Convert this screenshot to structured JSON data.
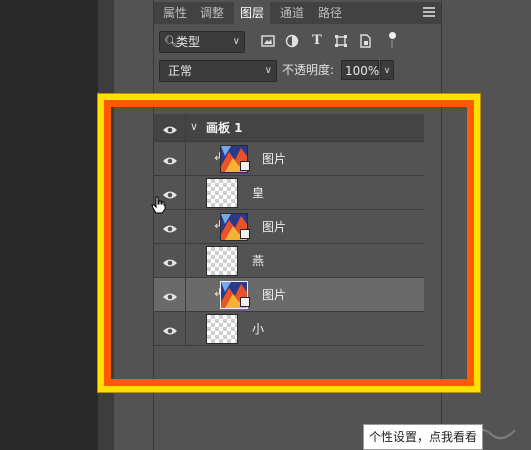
{
  "panel": {
    "tabs": [
      {
        "label": "属性"
      },
      {
        "label": "调整"
      },
      {
        "label": "图层"
      },
      {
        "label": "通道"
      },
      {
        "label": "路径"
      }
    ],
    "active_tab": "图层"
  },
  "filter": {
    "kind_label": "类型",
    "icons": [
      "pixel-layer-filter-icon",
      "adjustment-layer-filter-icon",
      "type-layer-filter-icon",
      "shape-layer-filter-icon",
      "smart-object-filter-icon"
    ]
  },
  "blend": {
    "mode": "正常",
    "opacity_label": "不透明度:",
    "opacity_value": "100%"
  },
  "layers": {
    "group": {
      "name": "画板 1"
    },
    "items": [
      {
        "name": "图片",
        "kind": "smart-object",
        "clipped": true,
        "selected": false
      },
      {
        "name": "皇",
        "kind": "text",
        "clipped": false,
        "selected": false
      },
      {
        "name": "图片",
        "kind": "smart-object",
        "clipped": true,
        "selected": false
      },
      {
        "name": "燕",
        "kind": "text",
        "clipped": false,
        "selected": false
      },
      {
        "name": "图片",
        "kind": "smart-object",
        "clipped": true,
        "selected": true
      },
      {
        "name": "小",
        "kind": "text",
        "clipped": false,
        "selected": false
      }
    ]
  },
  "tooltip": {
    "text": "个性设置，点我看看"
  },
  "colors": {
    "highlight_outer": "#ffe000",
    "highlight_inner": "#ff5a00",
    "panel_bg": "#535353",
    "selected_row": "#6a6a6a"
  }
}
